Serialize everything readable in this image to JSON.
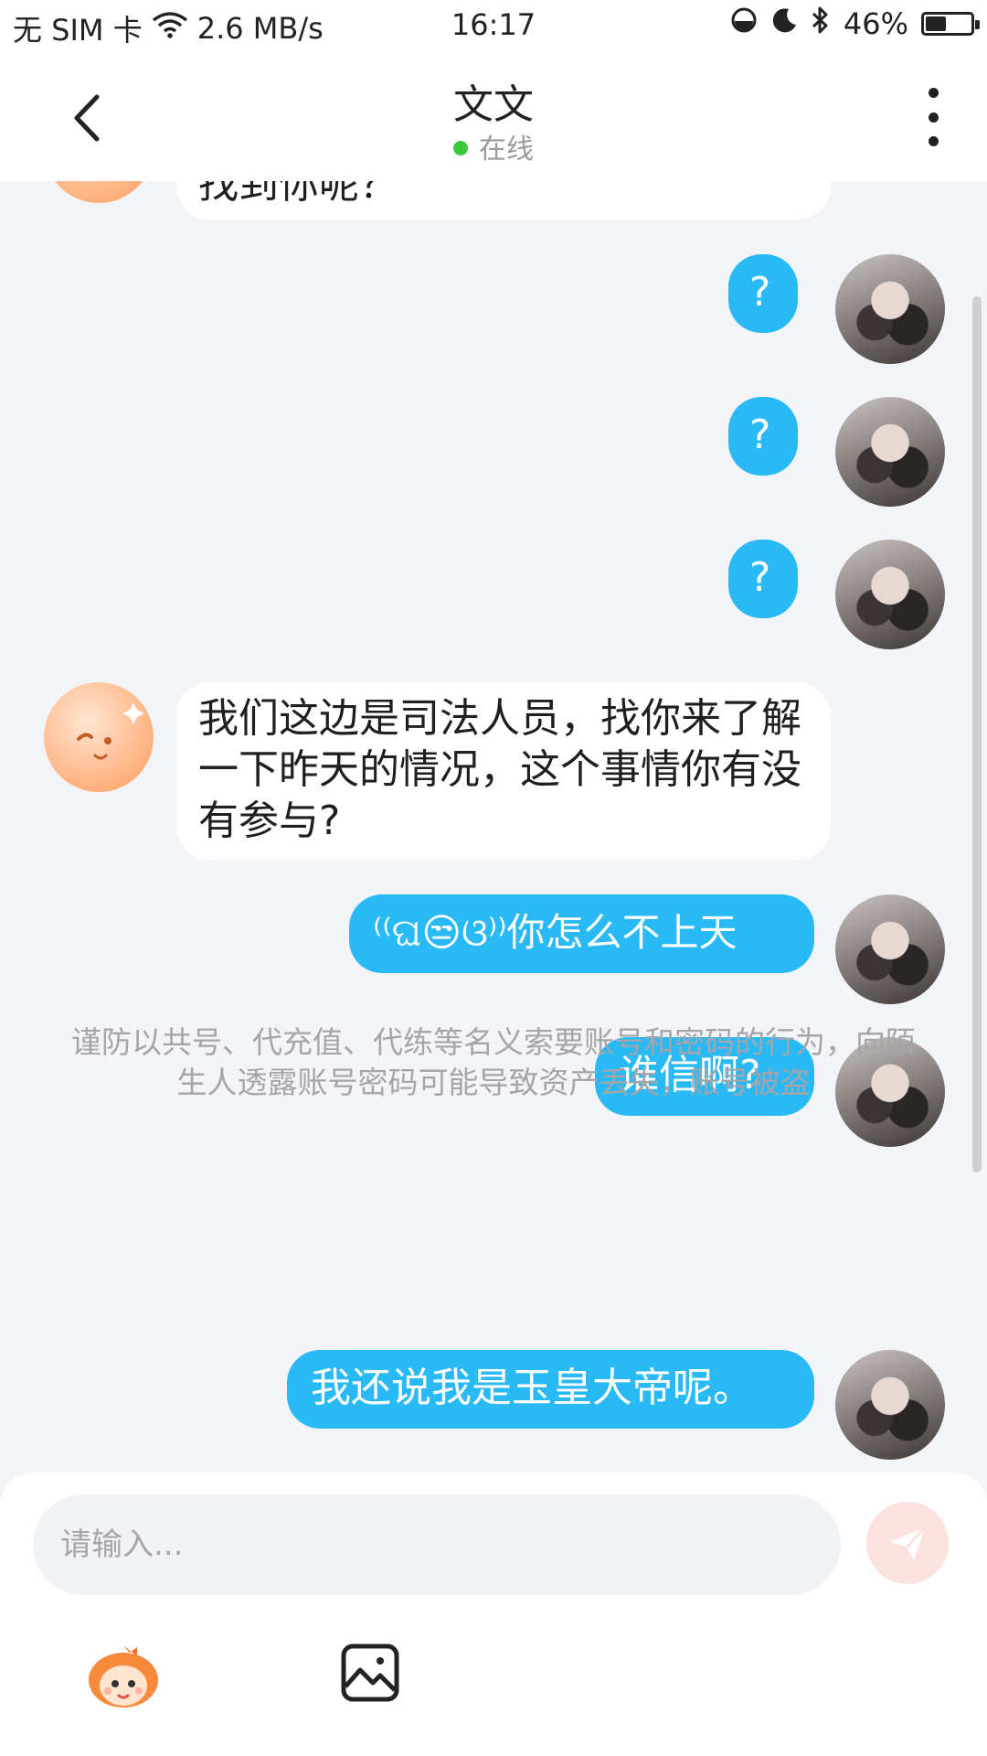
{
  "status_bar": {
    "carrier": "无 SIM 卡",
    "network_speed": "2.6 MB/s",
    "time": "16:17",
    "battery_percent": "46%",
    "battery_level": 0.46,
    "icons": [
      "wifi-icon",
      "data-saver-icon",
      "moon-icon",
      "bluetooth-icon",
      "battery-icon"
    ]
  },
  "header": {
    "title": "文文",
    "status": "在线",
    "status_color": "#3cc83c"
  },
  "messages": [
    {
      "side": "in",
      "text": "找到你呢？"
    },
    {
      "side": "out",
      "text": "?"
    },
    {
      "side": "out",
      "text": "?"
    },
    {
      "side": "out",
      "text": "?"
    },
    {
      "side": "in",
      "text": "我们这边是司法人员，找你来了解一下昨天的情况，这个事情你有没有参与?"
    },
    {
      "side": "out",
      "text_before": "⁽⁽ଘ",
      "emoji": "😒",
      "text_after": "ଓ⁾⁾你怎么不上天"
    },
    {
      "side": "out",
      "text": "谁信啊?"
    },
    {
      "side": "out",
      "text": "我还说我是玉皇大帝呢。"
    }
  ],
  "notice": "谨防以共号、代充值、代练等名义索要账号和密码的行为，向陌生人透露账号密码可能导致资产丢失，账号被盗",
  "composer": {
    "placeholder": "请输入...",
    "send_icon": "paper-plane-icon",
    "tools": [
      "emoji-icon",
      "image-icon"
    ]
  },
  "colors": {
    "outgoing_bubble": "#28b9f6",
    "incoming_bubble": "#ffffff",
    "chat_background": "#f3f4f7",
    "send_button": "#fde1df"
  }
}
